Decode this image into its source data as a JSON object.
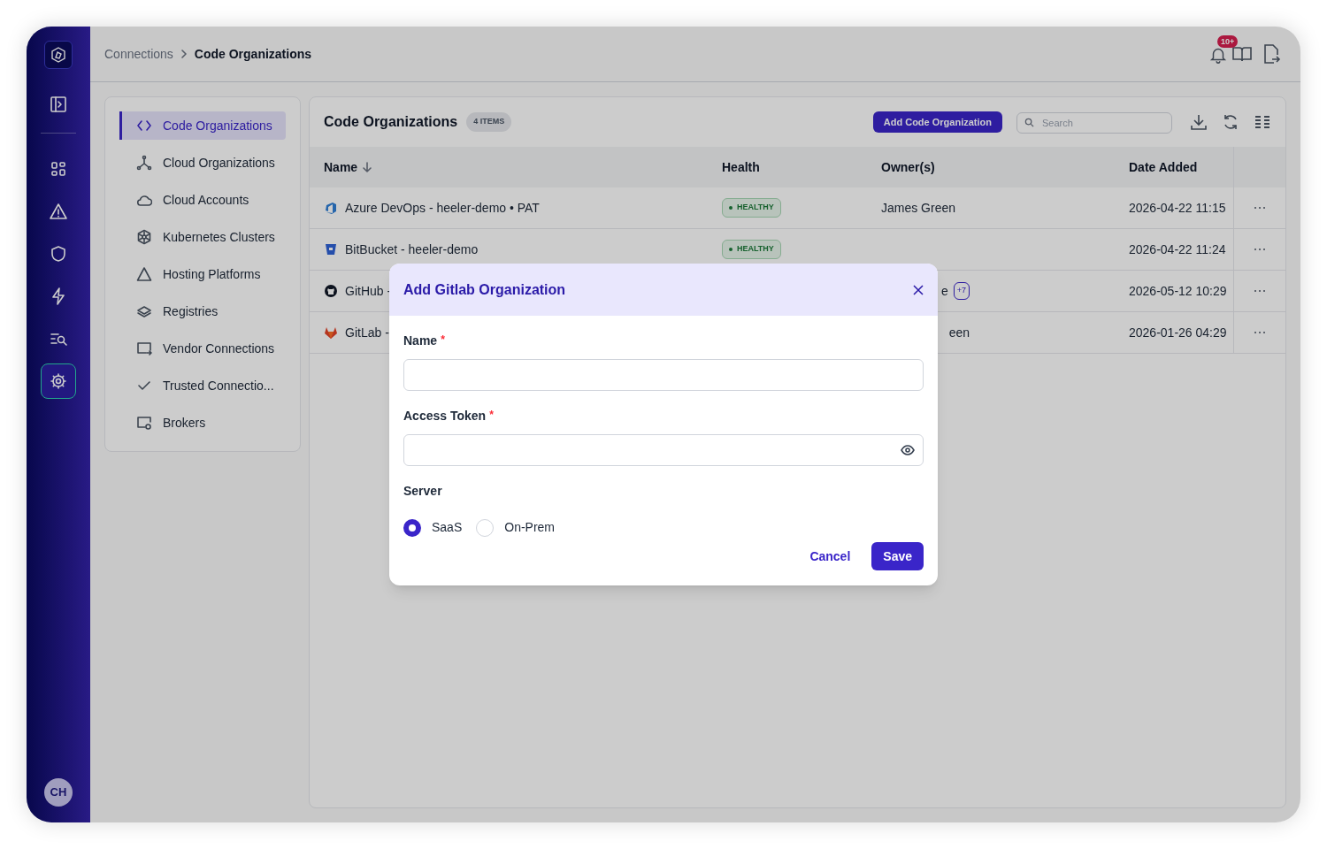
{
  "rail": {
    "items": [
      {
        "kind": "panel",
        "selected": false
      },
      {
        "kind": "grid",
        "selected": false
      },
      {
        "kind": "warning",
        "selected": false
      },
      {
        "kind": "shield",
        "selected": false
      },
      {
        "kind": "bolt",
        "selected": false
      },
      {
        "kind": "search",
        "selected": false
      },
      {
        "kind": "gear",
        "selected": true
      }
    ],
    "user": {
      "initials": "CH"
    }
  },
  "breadcrumb": [
    {
      "label": "Connections"
    },
    {
      "label": "Code Organizations"
    }
  ],
  "header": {
    "notification_badge": "10+"
  },
  "nav": {
    "items": [
      {
        "label": "Code Organizations",
        "kind": "code",
        "selected": true
      },
      {
        "label": "Cloud Organizations",
        "kind": "nodes",
        "selected": false
      },
      {
        "label": "Cloud Accounts",
        "kind": "cloud",
        "selected": false
      },
      {
        "label": "Kubernetes Clusters",
        "kind": "wheel",
        "selected": false
      },
      {
        "label": "Hosting Platforms",
        "kind": "triangle",
        "selected": false
      },
      {
        "label": "Registries",
        "kind": "layers",
        "selected": false
      },
      {
        "label": "Vendor Connections",
        "kind": "monitor",
        "selected": false
      },
      {
        "label": "Trusted Connectio...",
        "kind": "check",
        "selected": false
      },
      {
        "label": "Brokers",
        "kind": "broker",
        "selected": false
      }
    ]
  },
  "table": {
    "title": "Code Organizations",
    "count": "4 ITEMS",
    "add_button": "Add Code Organization",
    "search": {
      "placeholder": "Search"
    },
    "columns": [
      {
        "label": "Name",
        "sorted": true
      },
      {
        "label": "Health",
        "sorted": false
      },
      {
        "label": "Owner(s)",
        "sorted": false
      },
      {
        "label": "Date Added",
        "sorted": false
      }
    ],
    "rows": [
      {
        "kind": "azure",
        "name": "Azure DevOps - heeler-demo • PAT",
        "health": "HEALTHY",
        "owner": "James Green",
        "date": "2026-04-22 11:15"
      },
      {
        "kind": "bitbucket",
        "name": "BitBucket - heeler-demo",
        "health": "HEALTHY",
        "date": "2026-04-22 11:24"
      },
      {
        "kind": "github",
        "name": "GitHub -",
        "owner": "e",
        "owner_extra": "+7",
        "date": "2026-05-12 10:29"
      },
      {
        "kind": "gitlab",
        "name": "GitLab -",
        "owner": "een",
        "date": "2026-01-26 04:29"
      }
    ]
  },
  "modal": {
    "title": "Add Gitlab Organization",
    "fields": [
      {
        "label": "Name",
        "required_mark": "*",
        "kind": "text"
      },
      {
        "label": "Access Token",
        "required_mark": "*",
        "kind": "secret"
      }
    ],
    "server": {
      "label": "Server",
      "options": [
        {
          "label": "SaaS",
          "selected": true
        },
        {
          "label": "On-Prem",
          "selected": false
        }
      ]
    },
    "cancel": "Cancel",
    "save": "Save"
  }
}
